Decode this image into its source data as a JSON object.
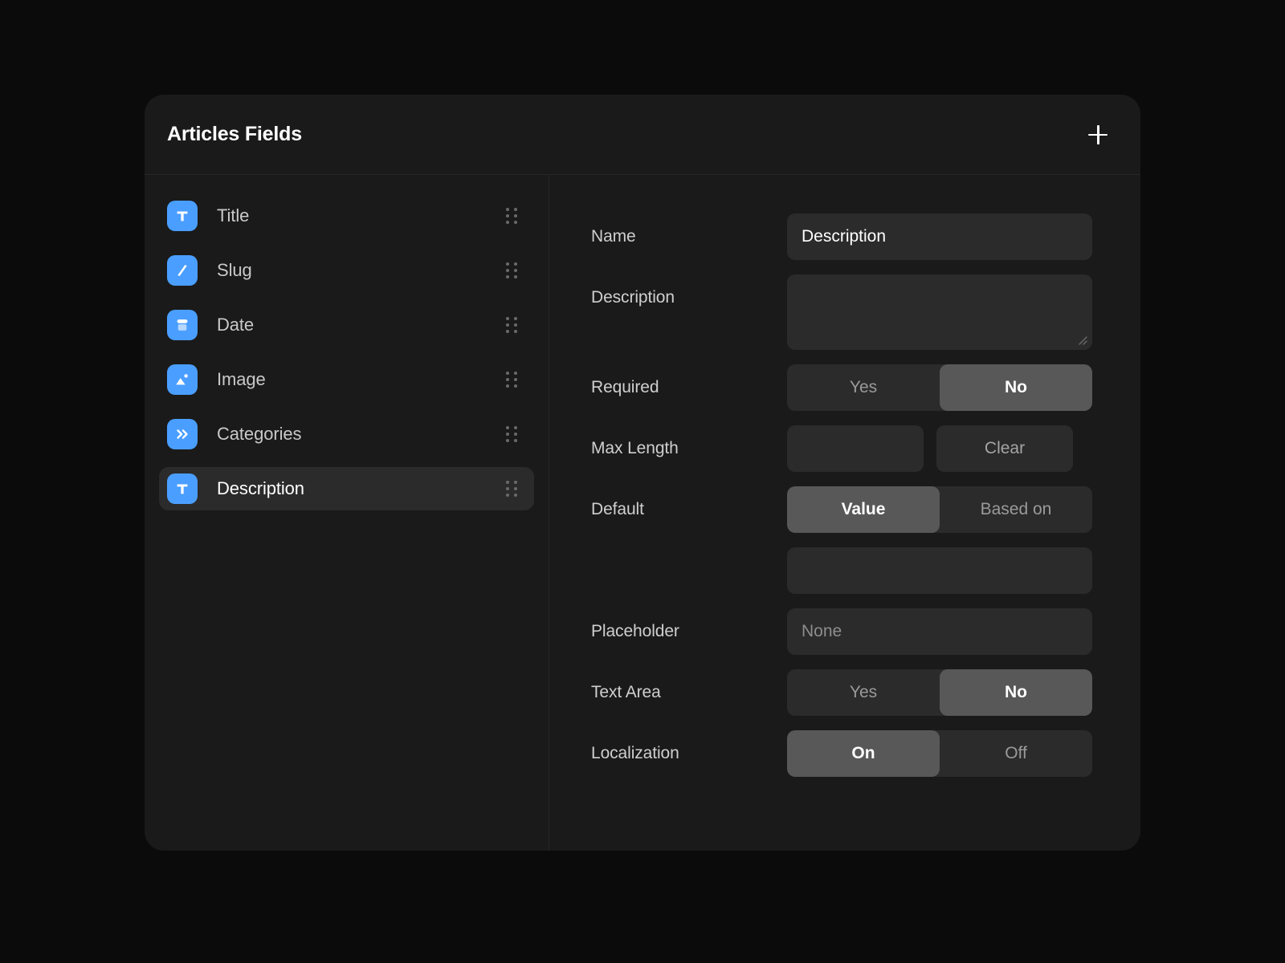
{
  "panel": {
    "title": "Articles Fields",
    "add_button_label": "+",
    "add_icon": "plus-icon"
  },
  "field_list": {
    "items": [
      {
        "label": "Title",
        "icon": "text-field-icon",
        "glyph": "T",
        "selected": false
      },
      {
        "label": "Slug",
        "icon": "slash-slug-icon",
        "glyph": "/",
        "selected": false
      },
      {
        "label": "Date",
        "icon": "calendar-date-icon",
        "glyph": "",
        "selected": false
      },
      {
        "label": "Image",
        "icon": "image-picture-icon",
        "glyph": "",
        "selected": false
      },
      {
        "label": "Categories",
        "icon": "double-chevron-icon",
        "glyph": "»",
        "selected": false
      },
      {
        "label": "Description",
        "icon": "text-field-icon",
        "glyph": "T",
        "selected": true
      }
    ],
    "drag_handle_icon": "drag-handle-icon"
  },
  "form": {
    "name": {
      "label": "Name",
      "value": "Description",
      "placeholder": ""
    },
    "description": {
      "label": "Description",
      "value": "",
      "placeholder": "",
      "resize_icon": "resize-grip-icon"
    },
    "required": {
      "label": "Required",
      "options": [
        "Yes",
        "No"
      ],
      "selected": "No"
    },
    "max_length": {
      "label": "Max Length",
      "value": "",
      "placeholder": "",
      "clear_label": "Clear"
    },
    "default": {
      "label": "Default",
      "options": [
        "Value",
        "Based on"
      ],
      "selected": "Value",
      "value": "",
      "value_placeholder": ""
    },
    "placeholder_field": {
      "label": "Placeholder",
      "value": "",
      "placeholder": "None"
    },
    "text_area": {
      "label": "Text Area",
      "options": [
        "Yes",
        "No"
      ],
      "selected": "No"
    },
    "localization": {
      "label": "Localization",
      "options": [
        "On",
        "Off"
      ],
      "selected": "On"
    }
  },
  "colors": {
    "background": "#0b0b0b",
    "panel": "#1a1a1a",
    "control": "#2b2b2b",
    "active_segment": "#585858",
    "accent": "#4a9eff",
    "text_primary": "#ffffff",
    "text_secondary": "#9a9a9a"
  }
}
